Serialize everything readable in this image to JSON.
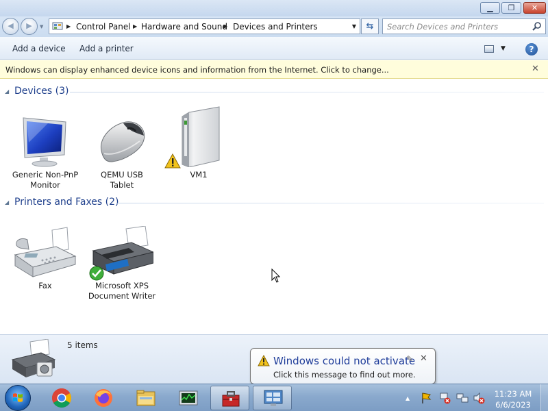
{
  "window": {
    "minimize_label": "▁",
    "maximize_label": "❐",
    "close_label": "✕"
  },
  "address": {
    "breadcrumbs": [
      "Control Panel",
      "Hardware and Sound",
      "Devices and Printers"
    ],
    "search_placeholder": "Search Devices and Printers"
  },
  "toolbar": {
    "add_device": "Add a device",
    "add_printer": "Add a printer",
    "help": "?"
  },
  "infobar": {
    "message": "Windows can display enhanced device icons and information from the Internet. Click to change...",
    "close": "✕"
  },
  "groups": [
    {
      "title": "Devices (3)",
      "items": [
        {
          "label_line1": "Generic Non-PnP",
          "label_line2": "Monitor",
          "icon": "monitor-icon"
        },
        {
          "label_line1": "QEMU USB",
          "label_line2": "Tablet",
          "icon": "mouse-icon"
        },
        {
          "label_line1": "VM1",
          "label_line2": "",
          "icon": "computer-tower-icon",
          "status": "warning"
        }
      ]
    },
    {
      "title": "Printers and Faxes (2)",
      "items": [
        {
          "label_line1": "Fax",
          "label_line2": "",
          "icon": "fax-icon"
        },
        {
          "label_line1": "Microsoft XPS",
          "label_line2": "Document Writer",
          "icon": "printer-icon",
          "status": "default"
        }
      ]
    }
  ],
  "details": {
    "count": "5 items"
  },
  "balloon": {
    "title": "Windows could not activate",
    "message": "Click this message to find out more.",
    "close": "✕"
  },
  "taskbar": {
    "apps": [
      "chrome-icon",
      "firefox-icon",
      "explorer-icon",
      "task-manager-icon",
      "toolbox-icon",
      "devices-printers-icon"
    ],
    "clock_time": "11:23 AM",
    "clock_date": "6/6/2023"
  },
  "colors": {
    "group_title": "#1e3f8c",
    "balloon_title": "#1f3d9a",
    "infobar_bg": "#fffddc"
  }
}
